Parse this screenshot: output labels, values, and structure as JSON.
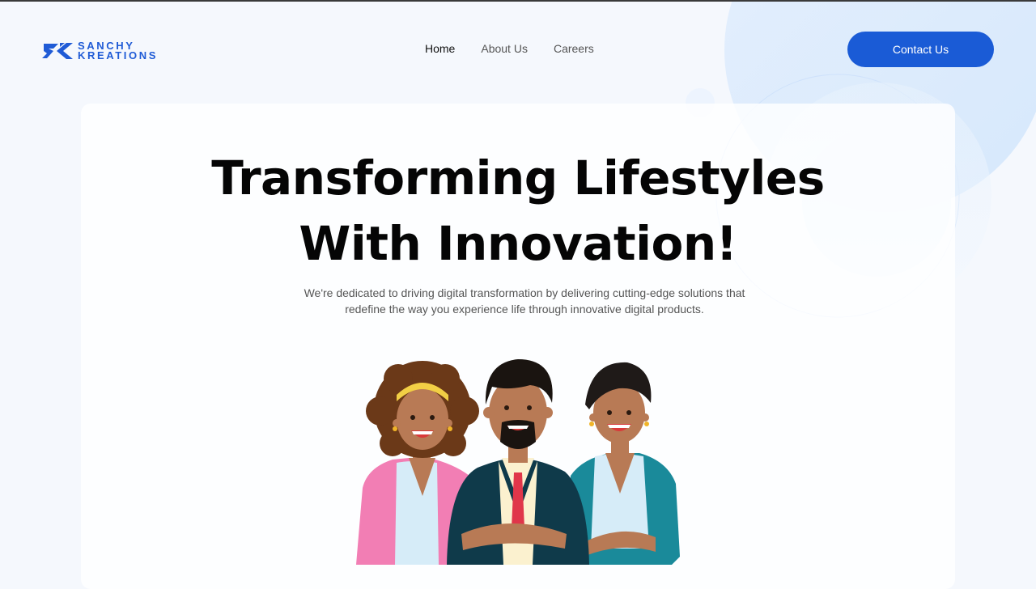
{
  "brand": {
    "line1": "SANCHY",
    "line2": "KREATIONS",
    "color": "#1f5bd6",
    "icon": "sk-logo-mark"
  },
  "nav": {
    "items": [
      {
        "label": "Home",
        "active": true
      },
      {
        "label": "About Us",
        "active": false
      },
      {
        "label": "Careers",
        "active": false
      }
    ]
  },
  "header": {
    "cta_label": "Contact Us",
    "cta_color": "#1a5bd6"
  },
  "hero": {
    "title_line1": "Transforming Lifestyles",
    "title_line2": "With Innovation!",
    "subtitle": "We're dedicated to driving digital transformation by delivering cutting-edge solutions that redefine the way you experience life through innovative digital products.",
    "illustration": "three-smiling-people-illustration"
  },
  "colors": {
    "page_background": "#f5f8fd",
    "decor_circle": "#dcebfd",
    "text_dark": "#050505",
    "text_muted": "#555555"
  }
}
